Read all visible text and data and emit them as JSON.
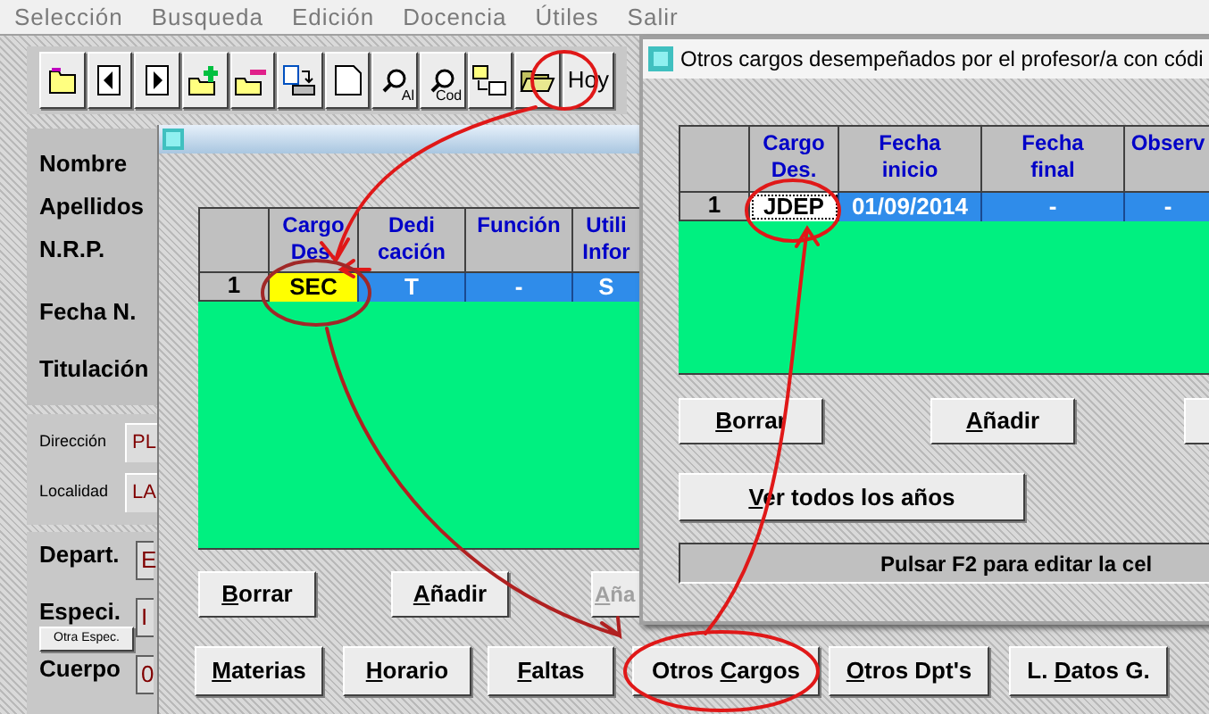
{
  "menu": [
    {
      "label": "Selección"
    },
    {
      "label": "Busqueda"
    },
    {
      "label": "Edición"
    },
    {
      "label": "Docencia"
    },
    {
      "label": "Útiles"
    },
    {
      "label": "Salir"
    }
  ],
  "toolbar": [
    {
      "kind": "icon"
    },
    {
      "kind": "icon"
    },
    {
      "kind": "icon"
    },
    {
      "kind": "icon"
    },
    {
      "kind": "icon"
    },
    {
      "kind": "icon"
    },
    {
      "kind": "icon"
    },
    {
      "kind": "icon",
      "caption": "Al"
    },
    {
      "kind": "icon",
      "caption": "Cod"
    },
    {
      "kind": "icon"
    },
    {
      "kind": "icon"
    },
    {
      "kind": "text",
      "label": "Hoy"
    }
  ],
  "form": {
    "labels": [
      "Nombre",
      "Apellidos",
      "N.R.P.",
      "Fecha N.",
      "Titulación"
    ],
    "address": [
      {
        "label": "Dirección",
        "value": "PL"
      },
      {
        "label": "Localidad",
        "value": "LA"
      }
    ],
    "department": [
      {
        "label": "Depart.",
        "value": "E"
      },
      {
        "label": "Especi.",
        "value": "I",
        "button": "Otra Espec."
      },
      {
        "label": "Cuerpo",
        "value": "0"
      }
    ]
  },
  "cargos_window": {
    "grid": {
      "edit_mode": false,
      "columns": [
        {
          "lines": [
            "Cargo",
            "Des."
          ]
        },
        {
          "lines": [
            "Dedi",
            "cación"
          ]
        },
        {
          "lines": [
            "Función"
          ]
        },
        {
          "lines": [
            "Utili",
            "Infor"
          ]
        }
      ],
      "rows": [
        {
          "number": "1",
          "cells": [
            {
              "text": "SEC",
              "selected": true
            },
            {
              "text": "T",
              "selected": false
            },
            {
              "text": "-",
              "selected": false
            },
            {
              "text": "S",
              "selected": false
            }
          ]
        }
      ]
    },
    "buttons": [
      {
        "key": "B",
        "post": "orrar",
        "disabled": false
      },
      {
        "key": "A",
        "post": "ñadir",
        "disabled": false
      },
      {
        "key": "A",
        "post": "ña",
        "disabled": true
      }
    ],
    "bottom_buttons": [
      {
        "key": "M",
        "post": "aterias"
      },
      {
        "key": "H",
        "post": "orario"
      },
      {
        "key": "F",
        "post": "altas"
      },
      {
        "pre": "Otros ",
        "key": "C",
        "post": "argos"
      },
      {
        "key": "O",
        "post": "tros Dpt's"
      },
      {
        "pre": "L. ",
        "key": "D",
        "post": "atos G."
      }
    ]
  },
  "otros_cargos_window": {
    "title": "Otros cargos desempeñados por el profesor/a con códi",
    "grid": {
      "edit_mode": true,
      "columns": [
        {
          "lines": [
            "Cargo",
            "Des."
          ]
        },
        {
          "lines": [
            "Fecha",
            "inicio"
          ]
        },
        {
          "lines": [
            "Fecha",
            "final"
          ]
        },
        {
          "lines": [
            "Observ"
          ]
        }
      ],
      "rows": [
        {
          "number": "1",
          "cells": [
            {
              "text": "JDEP",
              "selected": true
            },
            {
              "text": "01/09/2014",
              "selected": false
            },
            {
              "text": "-",
              "selected": false
            },
            {
              "text": "-",
              "selected": false
            }
          ]
        }
      ]
    },
    "buttons": [
      {
        "key": "B",
        "post": "orrar"
      },
      {
        "key": "A",
        "post": "ñadir"
      }
    ],
    "all_years_button": {
      "key": "V",
      "post": "er todos los años"
    },
    "status": "Pulsar F2 para editar la cel"
  }
}
